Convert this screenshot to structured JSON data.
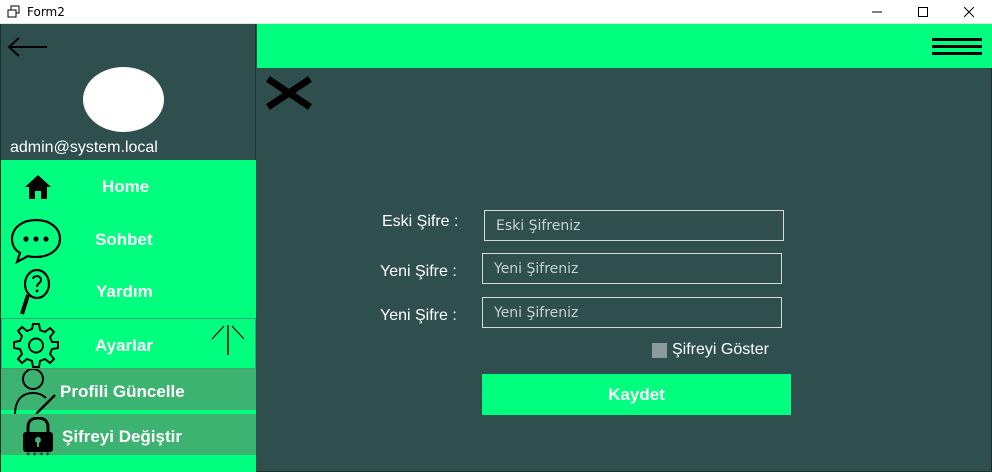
{
  "window": {
    "title": "Form2"
  },
  "sidebar": {
    "email": "admin@system.local",
    "menu": {
      "home": "Home",
      "chat": "Sohbet",
      "help": "Yardım",
      "settings": "Ayarlar",
      "profile": "Profili Güncelle",
      "password": "Şifreyi Değiştir"
    }
  },
  "form": {
    "old_password_label": "Eski Şifre :",
    "old_password_placeholder": "Eski Şifreniz",
    "new_password_label": "Yeni Şifre :",
    "new_password_placeholder": "Yeni Şifreniz",
    "confirm_password_label": "Yeni Şifre :",
    "confirm_password_placeholder": "Yeni Şifreniz",
    "show_password_label": "Şifreyi Göster",
    "save_label": "Kaydet"
  },
  "colors": {
    "accent": "#00ff7f",
    "background": "#2f4f4f",
    "submenu": "#3cb371"
  },
  "icons": [
    "back-arrow-icon",
    "home-icon",
    "chat-icon",
    "help-icon",
    "gear-icon",
    "collapse-icon",
    "user-edit-icon",
    "lock-icon",
    "hamburger-icon",
    "close-icon"
  ]
}
